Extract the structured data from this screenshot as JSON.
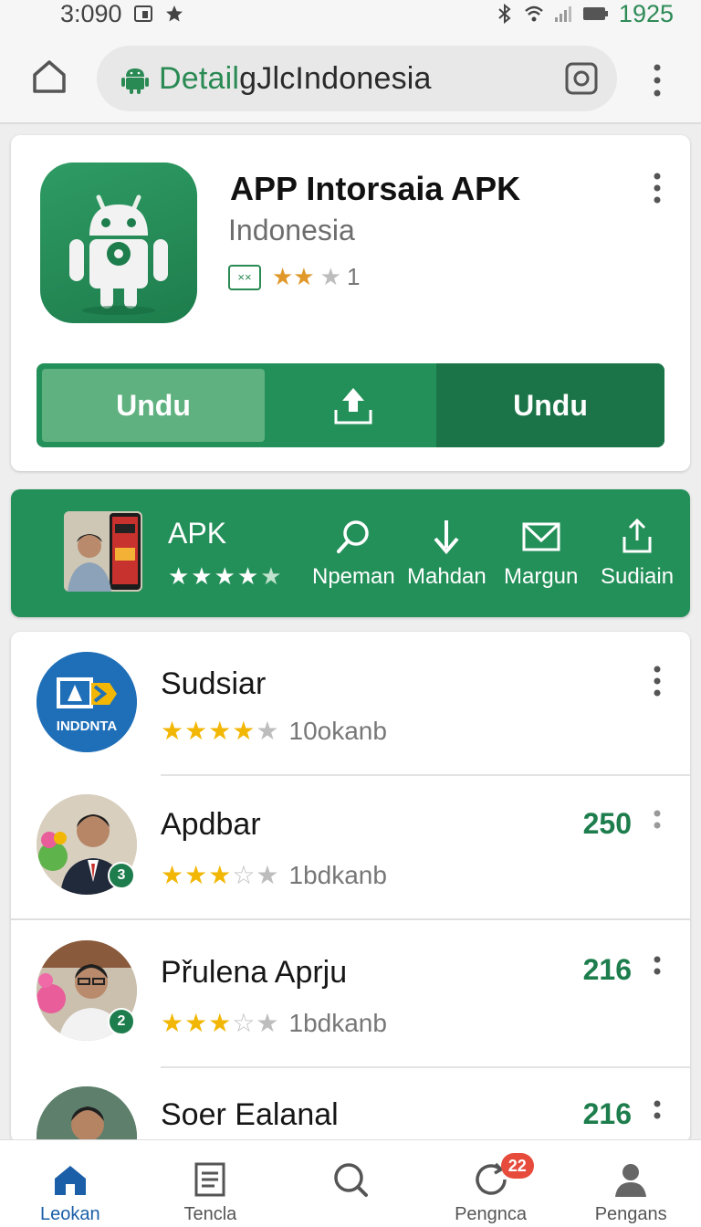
{
  "status_bar": {
    "time": "3:090",
    "battery_text": "1925"
  },
  "browser": {
    "url_highlight": "Detail",
    "url_rest": "gJlcIndonesia"
  },
  "app": {
    "title": "APP Intorsaia APK",
    "subtitle": "Indonesia",
    "rating_badge": "××",
    "stars": "★★",
    "stars_empty": "★",
    "rating_count": "1",
    "download_left_label": "Undu",
    "download_right_label": "Undu"
  },
  "banner": {
    "title": "APK",
    "stars": "★★★★",
    "stars_empty": "★",
    "actions": [
      {
        "label": "Npeman",
        "icon": "search-icon"
      },
      {
        "label": "Mahdan",
        "icon": "download-arrow-icon"
      },
      {
        "label": "Margun",
        "icon": "mail-icon"
      },
      {
        "label": "Sudiain",
        "icon": "share-icon"
      }
    ]
  },
  "list": [
    {
      "title": "Sudsiar",
      "stars": "★★★★",
      "stars_empty": "★",
      "meta": "10okanb",
      "count": "",
      "badge": ""
    },
    {
      "title": "Apdbar",
      "stars": "★★★",
      "stars_empty": "☆★",
      "meta": "1bdkanb",
      "count": "250",
      "badge": "3"
    },
    {
      "title": "Přulena Aprju",
      "stars": "★★★",
      "stars_empty": "☆★",
      "meta": "1bdkanb",
      "count": "216",
      "badge": "2"
    },
    {
      "title": "Soer Ealanal",
      "stars": "",
      "stars_empty": "",
      "meta": "",
      "count": "216",
      "badge": ""
    }
  ],
  "avatar_labels": {
    "first": "INDDNTA"
  },
  "bottom_nav": {
    "items": [
      {
        "label": "Leokan",
        "icon": "home-icon"
      },
      {
        "label": "Tencla",
        "icon": "document-icon"
      },
      {
        "label": "",
        "icon": "search-icon"
      },
      {
        "label": "Pengnca",
        "icon": "refresh-icon"
      },
      {
        "label": "Pengans",
        "icon": "profile-icon"
      }
    ],
    "notification_count": "22"
  },
  "colors": {
    "brand_green": "#23905a",
    "dark_green": "#1b7447",
    "star_gold": "#f2b705",
    "nav_active": "#1a5fa8",
    "badge_red": "#e64b3c"
  }
}
